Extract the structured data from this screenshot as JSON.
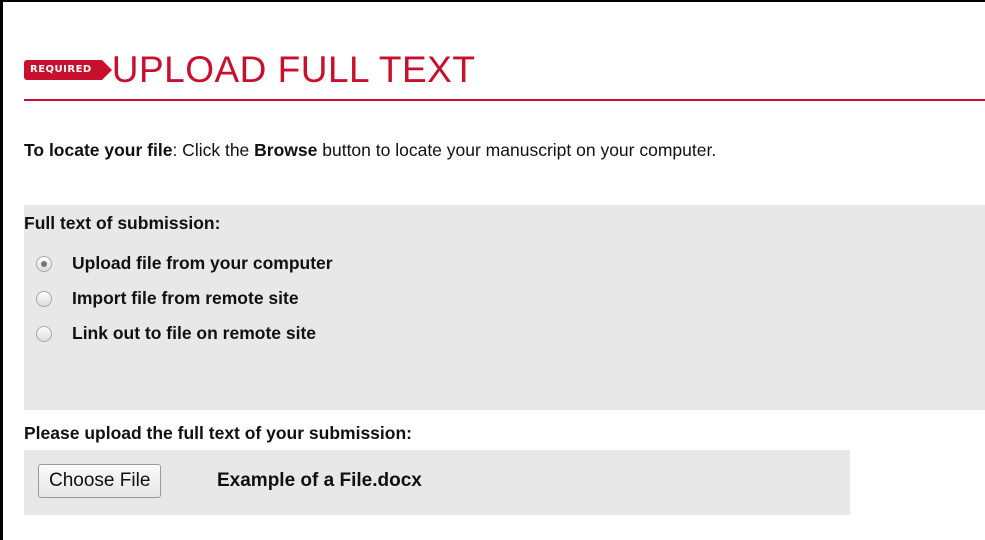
{
  "header": {
    "badge": "REQUIRED",
    "title": "UPLOAD FULL TEXT"
  },
  "instructions": {
    "lead": "To locate your file",
    "text_before": ": Click the ",
    "browse": "Browse",
    "text_after": " button to locate your manuscript on your computer."
  },
  "full_text": {
    "label": "Full text of submission:",
    "options": [
      {
        "label": "Upload file from your computer",
        "checked": true
      },
      {
        "label": "Import file from remote site",
        "checked": false
      },
      {
        "label": "Link out to file on remote site",
        "checked": false
      }
    ]
  },
  "upload": {
    "label": "Please upload the full text of your submission:",
    "button_label": "Choose File",
    "file_name": "Example of a File.docx"
  },
  "colors": {
    "accent": "#c8102e",
    "panel": "#e8e8e8"
  }
}
